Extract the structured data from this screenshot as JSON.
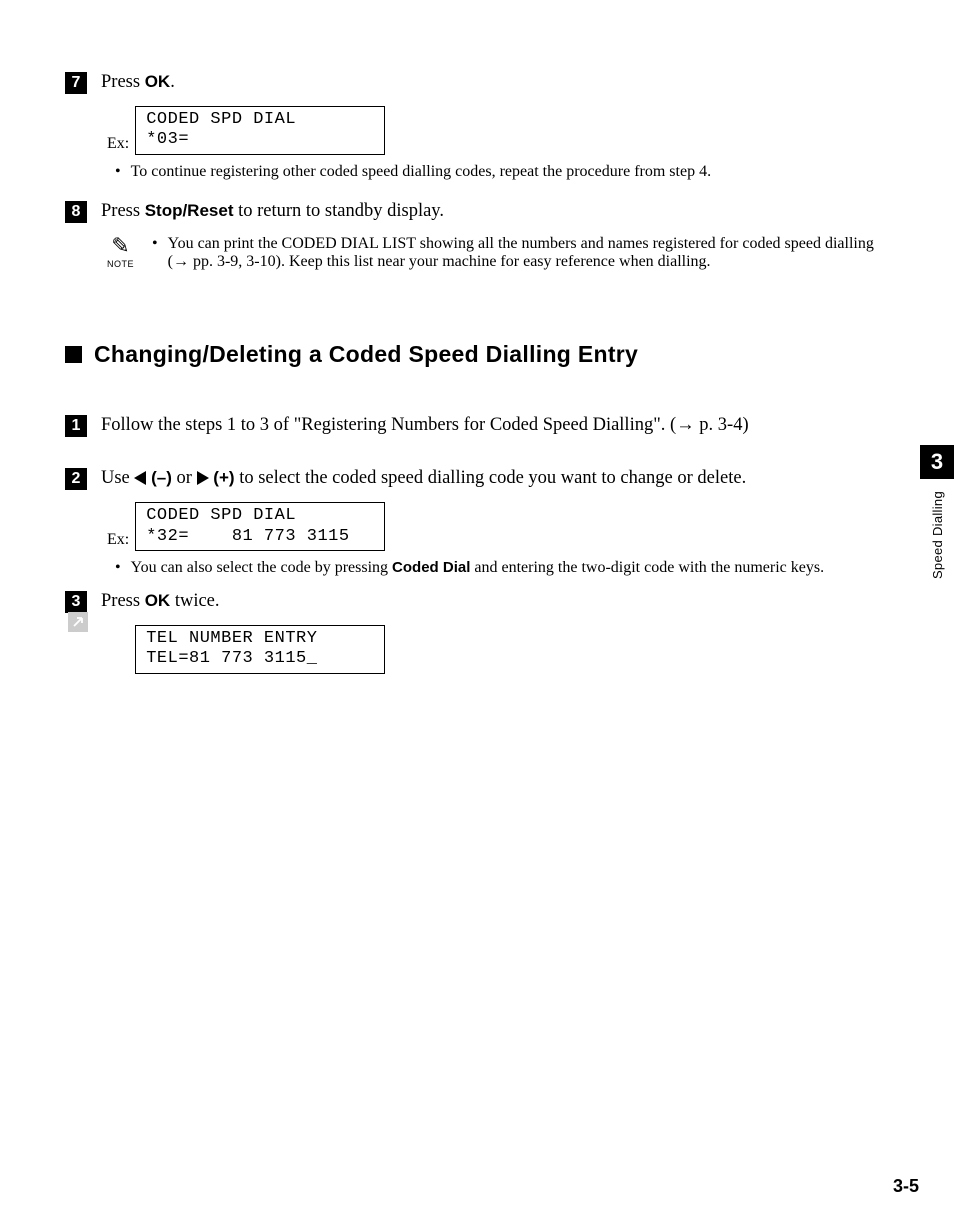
{
  "step7": {
    "num": "7",
    "text_pre": "Press ",
    "text_bold": "OK",
    "text_post": ".",
    "ex_label": "Ex:",
    "display": "CODED SPD DIAL\n*03=",
    "bullet": "To continue registering other coded speed dialling codes, repeat the procedure from step 4."
  },
  "step8": {
    "num": "8",
    "text_pre": "Press ",
    "text_bold": "Stop/Reset",
    "text_post": " to return to standby display.",
    "note_label": "NOTE",
    "note_text": "You can print the CODED DIAL LIST showing all the numbers and names registered for coded speed dialling (→ pp. 3-9, 3-10). Keep this list near your machine for easy reference when dialling."
  },
  "section_title": "Changing/Deleting a Coded Speed Dialling Entry",
  "step1": {
    "num": "1",
    "text": "Follow the steps 1 to 3 of \"Registering Numbers for Coded Speed Dialling\". (→ p. 3-4)"
  },
  "step2": {
    "num": "2",
    "text_pre": "Use ",
    "minus_bold": " (–)",
    "or": " or ",
    "plus_bold": " (+)",
    "text_post": " to select the coded speed dialling code you want to change or delete.",
    "ex_label": "Ex:",
    "display": "CODED SPD DIAL\n*32=    81 773 3115",
    "bullet_pre": "You can also select the code by pressing ",
    "bullet_bold": "Coded Dial",
    "bullet_post": " and entering the two-digit code with the numeric keys."
  },
  "step3": {
    "num": "3",
    "text_pre": "Press ",
    "text_bold": "OK",
    "text_post": " twice.",
    "display": "TEL NUMBER ENTRY\nTEL=81 773 3115_"
  },
  "side_tab": {
    "num": "3",
    "label": "Speed Dialling"
  },
  "page_number": "3-5"
}
